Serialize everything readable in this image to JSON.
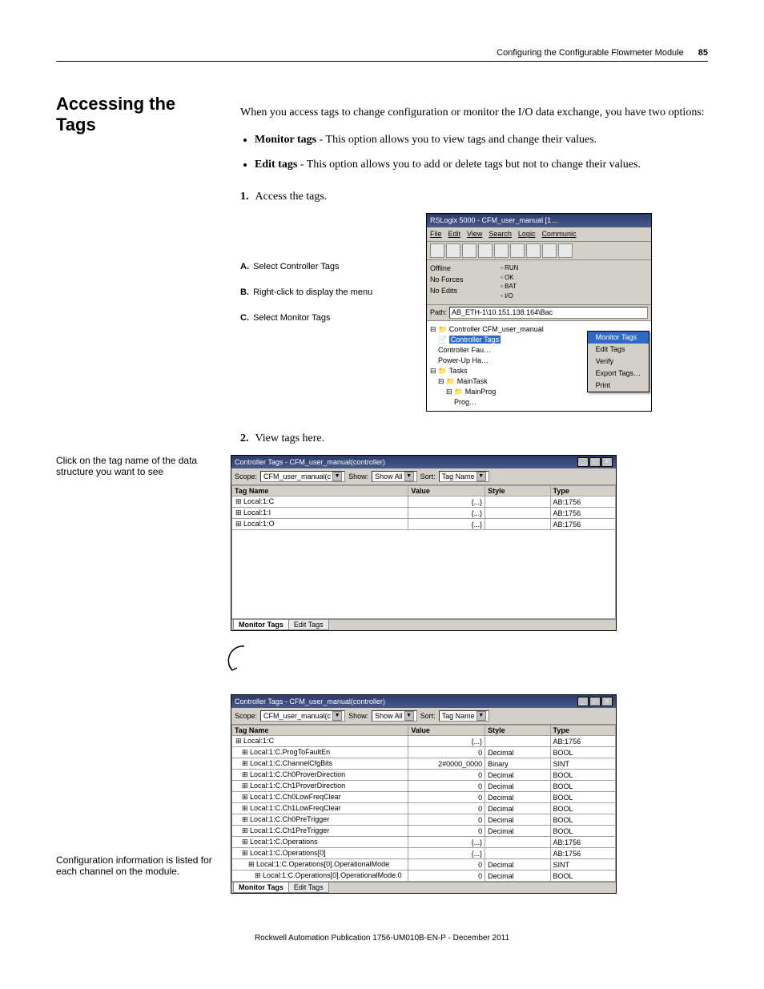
{
  "header": {
    "chapter": "Configuring the Configurable Flowmeter Module",
    "page": "85"
  },
  "section": {
    "title": "Accessing the Tags",
    "p1_a": "When you access tags to change configuration or monitor the I/O data exchange, you have two options:",
    "bullet1_label": "Monitor tags",
    "bullet1_rest": " - This option allows you to view tags and change their values.",
    "bullet2_label": "Edit tags",
    "bullet2_rest": " - This option allows you to add or delete tags but not to change their values.",
    "step1_num": "1.",
    "step1_text": "Access the tags.",
    "step2_num": "2.",
    "step2_text": "View tags here."
  },
  "callouts1": {
    "a": "Select Controller Tags",
    "b": "Right-click to display the menu",
    "c": "Select Monitor Tags"
  },
  "app1": {
    "title": "RSLogix 5000 - CFM_user_manual [1…",
    "menu": [
      "File",
      "Edit",
      "View",
      "Search",
      "Logic",
      "Communic"
    ],
    "status_left": [
      "Offline",
      "No Forces",
      "No Edits"
    ],
    "status_right": [
      "RUN",
      "OK",
      "BAT",
      "I/O"
    ],
    "path_label": "Path:",
    "path_value": "AB_ETH-1\\10.151.138.164\\Bac",
    "tree": {
      "root": "Controller CFM_user_manual",
      "sel": "Controller Tags",
      "n2": "Controller Fau…",
      "n3": "Power-Up Ha…",
      "tasks": "Tasks",
      "main": "MainTask",
      "mp": "MainProg",
      "prg": "Prog…"
    },
    "menu_items": [
      "Monitor Tags",
      "Edit Tags",
      "Verify",
      "Export Tags…",
      "Print"
    ]
  },
  "side1": "Click on the tag name of the data structure you want to see",
  "side2": "Configuration information is listed for each channel on the module.",
  "dw": {
    "title": "Controller Tags - CFM_user_manual(controller)",
    "scope_label": "Scope:",
    "scope_value": "CFM_user_manual(c",
    "show_label": "Show:",
    "show_value": "Show All",
    "sort_label": "Sort:",
    "sort_value": "Tag Name",
    "cols": [
      "Tag Name",
      "Value",
      "Style",
      "Type"
    ],
    "tabs": [
      "Monitor Tags",
      "Edit Tags"
    ]
  },
  "rows1": [
    {
      "name": "Local:1:C",
      "value": "{...}",
      "style": "",
      "type": "AB:1756"
    },
    {
      "name": "Local:1:I",
      "value": "{...}",
      "style": "",
      "type": "AB:1756"
    },
    {
      "name": "Local:1:O",
      "value": "{...}",
      "style": "",
      "type": "AB:1756"
    }
  ],
  "rows2": [
    {
      "name": "Local:1:C",
      "value": "{...}",
      "style": "",
      "type": "AB:1756"
    },
    {
      "name": "Local:1:C.ProgToFaultEn",
      "value": "0",
      "style": "Decimal",
      "type": "BOOL"
    },
    {
      "name": "Local:1:C.ChannelCfgBits",
      "value": "2#0000_0000",
      "style": "Binary",
      "type": "SINT"
    },
    {
      "name": "Local:1:C.Ch0ProverDirection",
      "value": "0",
      "style": "Decimal",
      "type": "BOOL"
    },
    {
      "name": "Local:1:C.Ch1ProverDirection",
      "value": "0",
      "style": "Decimal",
      "type": "BOOL"
    },
    {
      "name": "Local:1:C.Ch0LowFreqClear",
      "value": "0",
      "style": "Decimal",
      "type": "BOOL"
    },
    {
      "name": "Local:1:C.Ch1LowFreqClear",
      "value": "0",
      "style": "Decimal",
      "type": "BOOL"
    },
    {
      "name": "Local:1:C.Ch0PreTrigger",
      "value": "0",
      "style": "Decimal",
      "type": "BOOL"
    },
    {
      "name": "Local:1:C.Ch1PreTrigger",
      "value": "0",
      "style": "Decimal",
      "type": "BOOL"
    },
    {
      "name": "Local:1:C.Operations",
      "value": "{...}",
      "style": "",
      "type": "AB:1756"
    },
    {
      "name": "Local:1:C.Operations[0]",
      "value": "{...}",
      "style": "",
      "type": "AB:1756"
    },
    {
      "name": "Local:1:C.Operations[0].OperationalMode",
      "value": "0",
      "style": "Decimal",
      "type": "SINT"
    },
    {
      "name": "Local:1:C.Operations[0].OperationalMode.0",
      "value": "0",
      "style": "Decimal",
      "type": "BOOL"
    }
  ],
  "footer": "Rockwell Automation Publication 1756-UM010B-EN-P - December 2011"
}
